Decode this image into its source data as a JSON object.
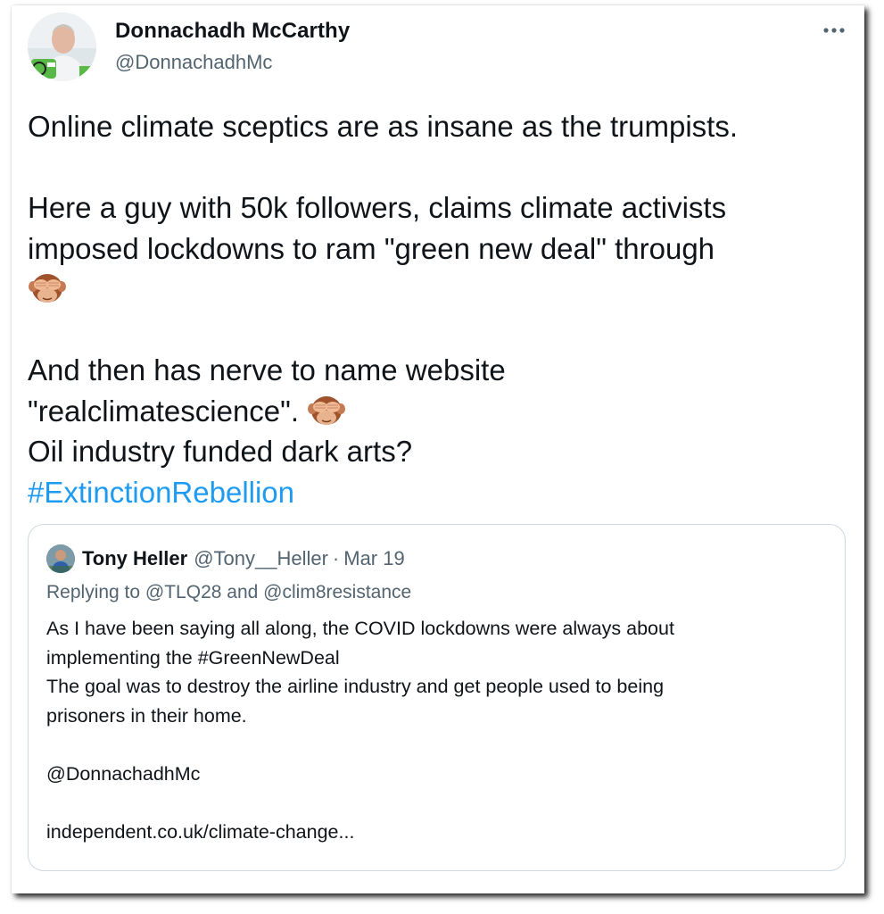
{
  "tweet": {
    "author_name": "Donnachadh McCarthy",
    "author_handle": "@DonnachadhMc",
    "more_icon": "more-horizontal-icon",
    "lines": {
      "l1": "Online climate sceptics are as insane as the trumpists.",
      "l2": "Here a guy with 50k followers, claims climate activists",
      "l3": "imposed lockdowns to ram \"green new deal\" through",
      "l4": "And then has nerve to name website",
      "l5": "\"realclimatescience\".",
      "l6": "Oil industry funded dark arts?"
    },
    "emoji_name": "see-no-evil-monkey",
    "hashtag": "#ExtinctionRebellion",
    "link_color": "#1d9bf0"
  },
  "quoted": {
    "author_name": "Tony Heller",
    "author_handle": "@Tony__Heller",
    "separator": "·",
    "date": "Mar 19",
    "replying_prefix": "Replying to",
    "reply_user_1": "@TLQ28",
    "reply_and": "and",
    "reply_user_2": "@clim8resistance",
    "lines": {
      "l1": "As I have been saying all along, the COVID lockdowns were always about",
      "l2": "implementing the #GreenNewDeal",
      "l3": "The goal was to destroy the airline industry and get people used to being",
      "l4": "prisoners in their home.",
      "l5": "@DonnachadhMc",
      "l6": "independent.co.uk/climate-change..."
    }
  }
}
